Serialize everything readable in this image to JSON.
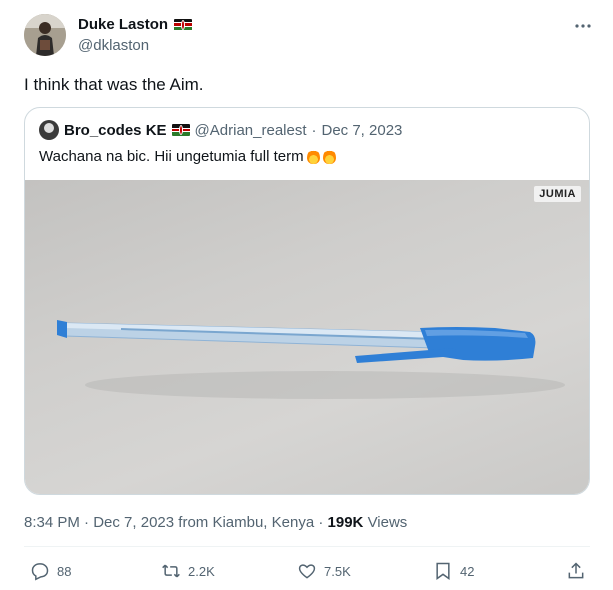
{
  "author": {
    "name": "Duke Laston",
    "handle": "@dklaston"
  },
  "tweet_text": "I think that was the Aim.",
  "quoted": {
    "name": "Bro_codes KE",
    "handle": "@Adrian_realest",
    "separator": "·",
    "date": "Dec 7, 2023",
    "text": "Wachana na bic. Hii ungetumia full term",
    "image_watermark": "JUMIA"
  },
  "meta": {
    "time": "8:34 PM",
    "dot1": "·",
    "date": "Dec 7, 2023",
    "location": "from Kiambu, Kenya",
    "dot2": "·",
    "views_count": "199K",
    "views_label": "Views"
  },
  "actions": {
    "replies": "88",
    "reposts": "2.2K",
    "likes": "7.5K",
    "bookmarks": "42"
  },
  "colors": {
    "text": "#0f1419",
    "secondary": "#536471",
    "border": "#cfd9de",
    "pen_blue": "#2f7fd6"
  },
  "icons": [
    "more-icon",
    "kenya-flag-icon",
    "fire-icon",
    "reply-icon",
    "repost-icon",
    "like-icon",
    "bookmark-icon",
    "share-icon"
  ]
}
